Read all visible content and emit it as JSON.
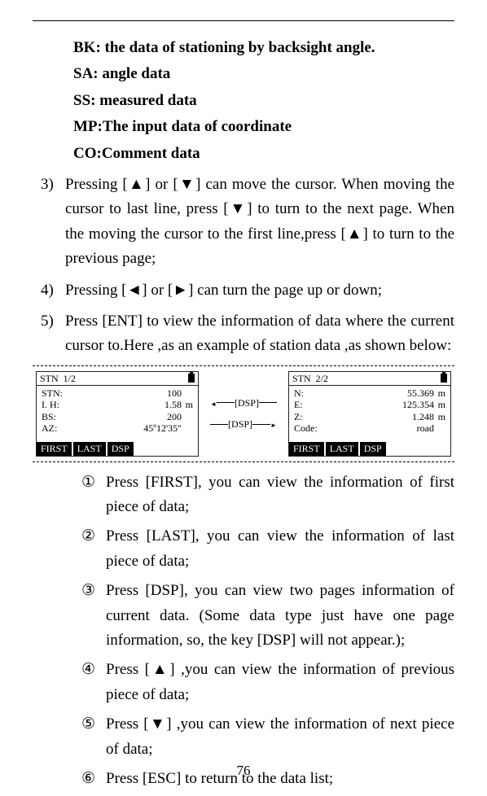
{
  "defs": {
    "bk": "BK: the data of stationing by backsight angle.",
    "sa": "SA: angle data",
    "ss": "SS: measured data",
    "mp": "MP:The input data of coordinate",
    "co": "CO:Comment data"
  },
  "items": {
    "n3": "3)",
    "t3": "Pressing [▲] or [▼] can move the cursor. When moving the cursor to last line, press [▼] to turn to the next page. When the moving the cursor to the first line,press [▲] to turn to the previous page;",
    "n4": "4)",
    "t4": "Pressing [◄] or [►] can turn the page up or down;",
    "n5": "5)",
    "t5": "Press [ENT] to view the information of data where the current cursor to.Here ,as an example of station data ,as shown below:"
  },
  "screen1": {
    "title_l": "STN",
    "title_r": "1/2",
    "r1l": "STN:",
    "r1v": "100",
    "r1u": "",
    "r2l": "I. H:",
    "r2v": "1.58",
    "r2u": "m",
    "r3l": "BS:",
    "r3v": "200",
    "r3u": "",
    "r4l": "AZ:",
    "r4v": "45º12'35\"",
    "r4u": "",
    "f1": "FIRST",
    "f2": "LAST",
    "f3": "DSP"
  },
  "dsp": "[DSP]",
  "screen2": {
    "title_l": "STN",
    "title_r": "2/2",
    "r1l": "N:",
    "r1v": "55.369",
    "r1u": "m",
    "r2l": "E:",
    "r2v": "125.354",
    "r2u": "m",
    "r3l": "Z:",
    "r3v": "1.248",
    "r3u": "m",
    "r4l": "Code:",
    "r4v": "road",
    "r4u": "",
    "f1": "FIRST",
    "f2": "LAST",
    "f3": "DSP"
  },
  "sub": {
    "n1": "①",
    "t1": "Press [FIRST], you can view the information of first piece of data;",
    "n2": "②",
    "t2": "Press [LAST], you can view the information of last piece of data;",
    "n3": "③",
    "t3": "Press [DSP], you can view two pages information of current data. (Some data type just have one page information, so, the key [DSP] will not appear.);",
    "n4": "④",
    "t4": "Press [▲] ,you can view the information of previous piece of data;",
    "n5": "⑤",
    "t5": "Press [▼] ,you can view the information of next piece of data;",
    "n6": "⑥",
    "t6": "Press [ESC] to return to the data list;"
  },
  "pagenum": "76"
}
